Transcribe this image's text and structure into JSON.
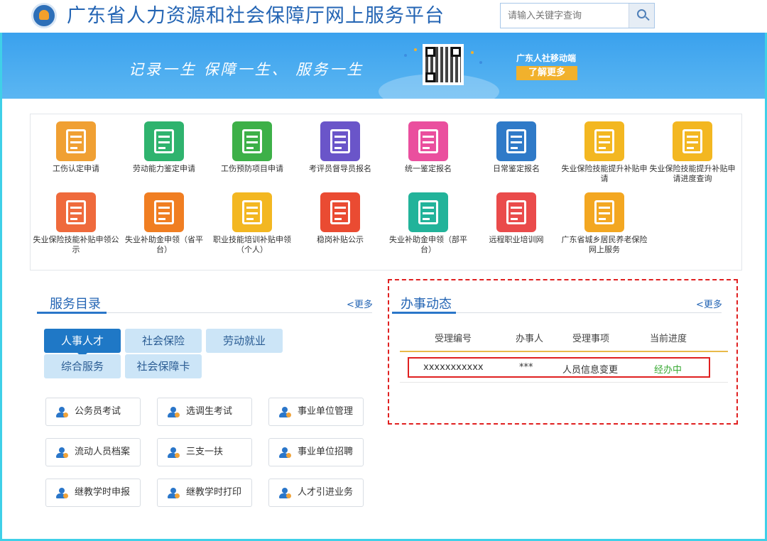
{
  "header": {
    "site_title": "广东省人力资源和社会保障厅网上服务平台",
    "search_placeholder": "请输入关键字查询"
  },
  "banner": {
    "slogan": "记录一生  保障一生、  服务一生",
    "mobile_title": "广东人社移动端",
    "more_label": "了解更多"
  },
  "services": [
    {
      "label": "工伤认定申请",
      "color": "#f0a033"
    },
    {
      "label": "劳动能力鉴定申请",
      "color": "#2fb36e"
    },
    {
      "label": "工伤预防项目申请",
      "color": "#3db048"
    },
    {
      "label": "考评员督导员报名",
      "color": "#6a55c9"
    },
    {
      "label": "统一鉴定报名",
      "color": "#ea4f9e"
    },
    {
      "label": "日常鉴定报名",
      "color": "#2f7ac8"
    },
    {
      "label": "失业保险技能提升补贴申请",
      "color": "#f3b721"
    },
    {
      "label": "失业保险技能提升补贴申请进度查询",
      "color": "#f3b721"
    },
    {
      "label": "失业保险技能补贴申领公示",
      "color": "#ef6a3c"
    },
    {
      "label": "失业补助金申领（省平台）",
      "color": "#f07e22"
    },
    {
      "label": "职业技能培训补贴申领（个人）",
      "color": "#f3b721"
    },
    {
      "label": "稳岗补贴公示",
      "color": "#ea4b32"
    },
    {
      "label": "失业补助金申领（部平台）",
      "color": "#22b39a"
    },
    {
      "label": "远程职业培训网",
      "color": "#ea4b4b"
    },
    {
      "label": "广东省城乡居民养老保险网上服务",
      "color": "#f3a721"
    }
  ],
  "directory": {
    "title": "服务目录",
    "more": "<更多",
    "tabs": [
      "人事人才",
      "社会保险",
      "劳动就业",
      "综合服务",
      "社会保障卡"
    ],
    "buttons": [
      "公务员考试",
      "选调生考试",
      "事业单位管理",
      "流动人员档案",
      "三支一扶",
      "事业单位招聘",
      "继教学时申报",
      "继教学时打印",
      "人才引进业务"
    ]
  },
  "dynamics": {
    "title": "办事动态",
    "more": "<更多",
    "headers": [
      "受理编号",
      "办事人",
      "受理事项",
      "当前进度"
    ],
    "row": {
      "number": "xxxxxxxxxxx",
      "person": "***",
      "item": "人员信息变更",
      "status": "经办中"
    }
  },
  "colors": {
    "accent": "#2465b4",
    "banner": "#3aa1ee",
    "highlight": "#e02020"
  }
}
